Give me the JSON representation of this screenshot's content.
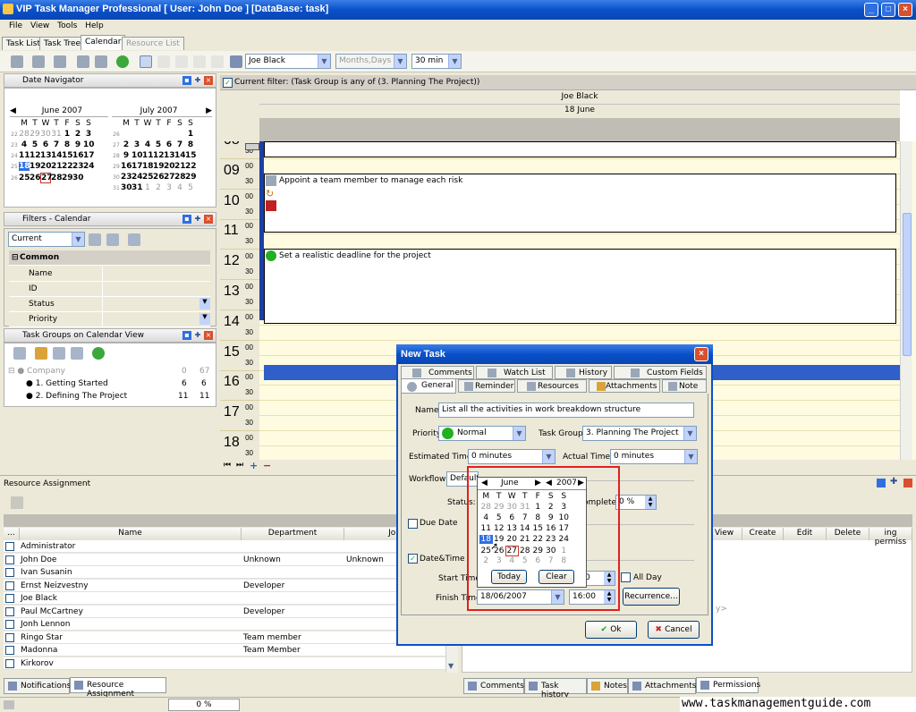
{
  "window": {
    "title": "VIP Task Manager Professional [ User: John Doe ] [DataBase: task]"
  },
  "menu": [
    "File",
    "View",
    "Tools",
    "Help"
  ],
  "main_tabs": [
    {
      "label": "Task List"
    },
    {
      "label": "Task Tree"
    },
    {
      "label": "Calendar"
    },
    {
      "label": "Resource List"
    }
  ],
  "toolbar": {
    "resource": "Joe Black",
    "view_mode": "Months,Days",
    "interval": "30 min"
  },
  "date_navigator": {
    "title": "Date Navigator",
    "june": {
      "title": "June 2007",
      "weeks": [
        {
          "wk": "22",
          "days": [
            "28",
            "29",
            "30",
            "31",
            "1",
            "2",
            "3"
          ]
        },
        {
          "wk": "23",
          "days": [
            "4",
            "5",
            "6",
            "7",
            "8",
            "9",
            "10"
          ]
        },
        {
          "wk": "24",
          "days": [
            "11",
            "12",
            "13",
            "14",
            "15",
            "16",
            "17"
          ]
        },
        {
          "wk": "25",
          "days": [
            "18",
            "19",
            "20",
            "21",
            "22",
            "23",
            "24"
          ]
        },
        {
          "wk": "26",
          "days": [
            "25",
            "26",
            "27",
            "28",
            "29",
            "30",
            ""
          ]
        }
      ]
    },
    "july": {
      "title": "July 2007",
      "weeks": [
        {
          "wk": "26",
          "days": [
            "",
            "",
            "",
            "",
            "",
            "",
            "1"
          ]
        },
        {
          "wk": "27",
          "days": [
            "2",
            "3",
            "4",
            "5",
            "6",
            "7",
            "8"
          ]
        },
        {
          "wk": "28",
          "days": [
            "9",
            "10",
            "11",
            "12",
            "13",
            "14",
            "15"
          ]
        },
        {
          "wk": "29",
          "days": [
            "16",
            "17",
            "18",
            "19",
            "20",
            "21",
            "22"
          ]
        },
        {
          "wk": "30",
          "days": [
            "23",
            "24",
            "25",
            "26",
            "27",
            "28",
            "29"
          ]
        },
        {
          "wk": "31",
          "days": [
            "30",
            "31",
            "1",
            "2",
            "3",
            "4",
            "5"
          ]
        }
      ]
    },
    "dow": [
      "M",
      "T",
      "W",
      "T",
      "F",
      "S",
      "S"
    ]
  },
  "filters": {
    "title": "Filters - Calendar",
    "current": "Current",
    "group": "Common",
    "fields": [
      "Name",
      "ID",
      "Status",
      "Priority"
    ]
  },
  "task_groups": {
    "title": "Task Groups on Calendar View",
    "items": [
      {
        "name": "Company",
        "a": "0",
        "b": "67"
      },
      {
        "name": "1. Getting Started",
        "a": "6",
        "b": "6"
      },
      {
        "name": "2. Defining The Project",
        "a": "11",
        "b": "11"
      }
    ]
  },
  "calendar": {
    "filter_text": "Current filter:   (Task Group is any of (3. Planning The Project))",
    "resource": "Joe Black",
    "date": "18 June",
    "hours": [
      "08",
      "09",
      "10",
      "11",
      "12",
      "13",
      "14",
      "15",
      "16",
      "17",
      "18"
    ],
    "min00": "00",
    "min30": "30",
    "events": [
      "Appoint a team member to manage each risk",
      "Set a realistic deadline for the project"
    ]
  },
  "resource_assignment": {
    "title": "Resource Assignment",
    "columns": [
      "...",
      "Name",
      "Department",
      "Job"
    ],
    "rows": [
      {
        "name": "Administrator",
        "dept": "",
        "job": ""
      },
      {
        "name": "John Doe",
        "dept": "Unknown",
        "job": "Unknown"
      },
      {
        "name": "Ivan Susanin",
        "dept": "",
        "job": ""
      },
      {
        "name": "Ernst Neizvestny",
        "dept": "Developer",
        "job": ""
      },
      {
        "name": "Joe Black",
        "dept": "",
        "job": ""
      },
      {
        "name": "Paul McCartney",
        "dept": "Developer",
        "job": ""
      },
      {
        "name": "Jonh Lennon",
        "dept": "",
        "job": ""
      },
      {
        "name": "Ringo Star",
        "dept": "Team member",
        "job": ""
      },
      {
        "name": "Madonna",
        "dept": "Team Member",
        "job": ""
      },
      {
        "name": "Kirkorov",
        "dept": "",
        "job": ""
      }
    ],
    "perm_columns": [
      "View",
      "Create",
      "Edit",
      "Delete",
      "ing permiss"
    ]
  },
  "bottom_tabs_left": [
    "Notifications",
    "Resource Assignment"
  ],
  "bottom_tabs_right": [
    "Comments",
    "Task history",
    "Notes",
    "Attachments",
    "Permissions"
  ],
  "status": {
    "progress": "0 %"
  },
  "watermark": "www.taskmanagementguide.com",
  "dialog": {
    "title": "New Task",
    "tabs_row1": [
      "Comments",
      "Watch List",
      "History",
      "Custom Fields"
    ],
    "tabs_row2": [
      "General",
      "Reminder",
      "Resources",
      "Attachments",
      "Note"
    ],
    "name_label": "Name:",
    "name_value": "List all the activities in work breakdown structure",
    "priority_label": "Priority:",
    "priority_value": "Normal",
    "taskgroup_label": "Task Group:",
    "taskgroup_value": "3. Planning The Project",
    "est_label": "Estimated Time:",
    "est_value": "0 minutes",
    "act_label": "Actual Time:",
    "act_value": "0 minutes",
    "workflow_label": "Workflow",
    "workflow_value": "Default",
    "status_label": "Status:",
    "complete_label": "omplete:",
    "complete_value": "0 %",
    "due_label": "Due Date",
    "datetime_label": "Date&Time",
    "start_label": "Start Time:",
    "start_time": "0",
    "allday_label": "All Day",
    "finish_label": "Finish Time:",
    "finish_date": "18/06/2007",
    "finish_time": "16:00",
    "recurrence": "Recurrence...",
    "ok": "Ok",
    "cancel": "Cancel",
    "popup": {
      "month": "June",
      "year": "2007",
      "dow": [
        "M",
        "T",
        "W",
        "T",
        "F",
        "S",
        "S"
      ],
      "weeks": [
        [
          "28",
          "29",
          "30",
          "31",
          "1",
          "2",
          "3"
        ],
        [
          "4",
          "5",
          "6",
          "7",
          "8",
          "9",
          "10"
        ],
        [
          "11",
          "12",
          "13",
          "14",
          "15",
          "16",
          "17"
        ],
        [
          "18",
          "19",
          "20",
          "21",
          "22",
          "23",
          "24"
        ],
        [
          "25",
          "26",
          "27",
          "28",
          "29",
          "30",
          "1"
        ],
        [
          "2",
          "3",
          "4",
          "5",
          "6",
          "7",
          "8"
        ]
      ],
      "today": "Today",
      "clear": "Clear"
    }
  }
}
